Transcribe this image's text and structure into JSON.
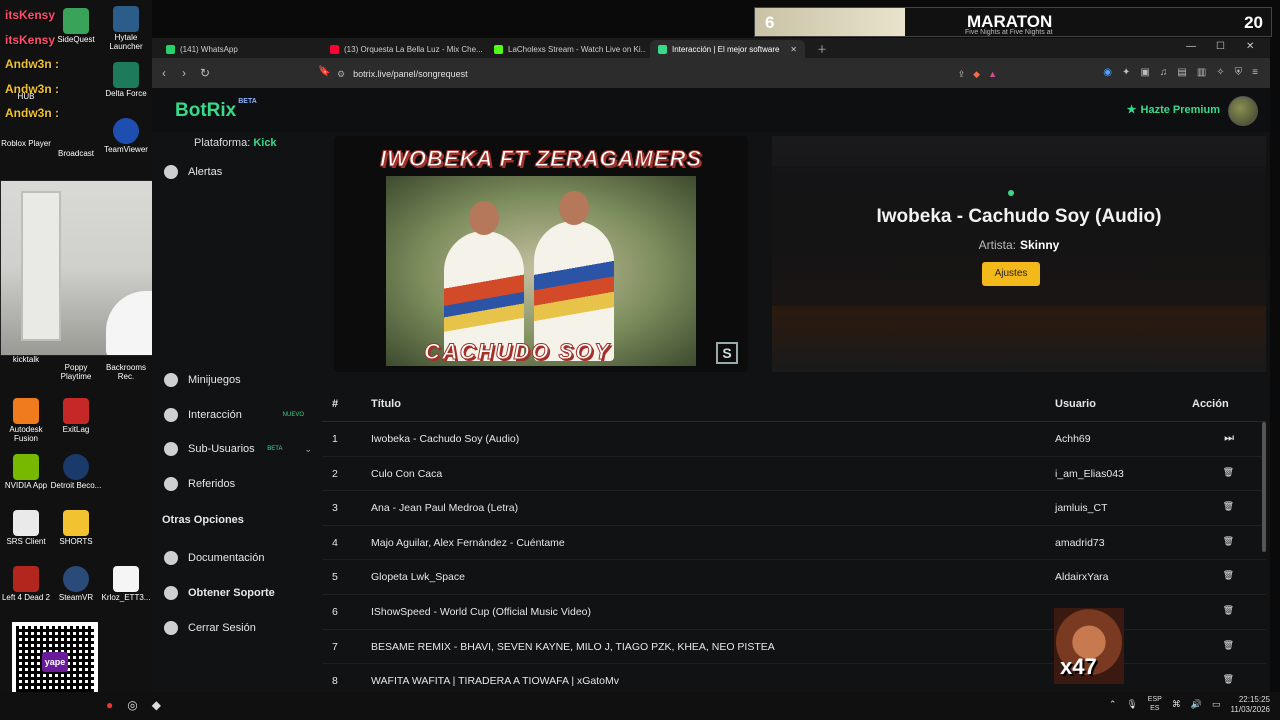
{
  "desktop": {
    "overlay_names": [
      "itsKensy",
      "itsKensy",
      "Andw3n :",
      "Andw3n :",
      "Andw3n :"
    ],
    "icons": [
      {
        "label": "SideQuest"
      },
      {
        "label": "Hytale Launcher"
      },
      {
        "label": "HUB"
      },
      {
        "label": "Delta Force"
      },
      {
        "label": "Roblox Player"
      },
      {
        "label": "Broadcast"
      },
      {
        "label": "TeamViewer"
      },
      {
        "label": "kicktalk"
      },
      {
        "label": "Poppy Playtime"
      },
      {
        "label": "Backrooms Rec."
      },
      {
        "label": "Autodesk Fusion"
      },
      {
        "label": "ExitLag"
      },
      {
        "label": "NVIDIA App"
      },
      {
        "label": "Detroit Beco..."
      },
      {
        "label": "SRS Client"
      },
      {
        "label": "SHORTS"
      },
      {
        "label": "Left 4 Dead 2"
      },
      {
        "label": "SteamVR"
      },
      {
        "label": "Krloz_ETT3..."
      }
    ],
    "qr_label": "yape"
  },
  "maraton": {
    "left_number": "6",
    "title": "MARATON",
    "subtitle": "Five Nights at Five Nights at",
    "right_number": "20",
    "progress": 0.29
  },
  "browser": {
    "tabs": [
      {
        "label": "(141) WhatsApp",
        "color": "#25d366"
      },
      {
        "label": "(13) Orquesta La Bella Luz - Mix Che...",
        "color": "#ff0033"
      },
      {
        "label": "LaCholexs Stream - Watch Live on Ki...",
        "color": "#53fc18"
      },
      {
        "label": "Interacción | El mejor software",
        "color": "#39d98a"
      }
    ],
    "url": "botrix.live/panel/songrequest"
  },
  "app": {
    "logo": "BotRix",
    "logo_badge": "BETA",
    "premium_label": "Hazte Premium",
    "platform_label": "Plataforma:",
    "platform_value": "Kick",
    "nav": [
      {
        "label": "Alertas"
      },
      {
        "label": "Minijuegos"
      },
      {
        "label": "Interacción",
        "badge": "NUEVO"
      },
      {
        "label": "Sub-Usuarios",
        "badge": "BETA"
      },
      {
        "label": "Referidos"
      }
    ],
    "other_options_title": "Otras Opciones",
    "other_nav": [
      {
        "label": "Documentación"
      },
      {
        "label": "Obtener Soporte"
      },
      {
        "label": "Cerrar Sesión"
      }
    ],
    "video": {
      "caption_top": "IWOBEKA FT ZERAGAMERS",
      "caption_bottom": "CACHUDO SOY",
      "watermark": "S"
    },
    "now_playing": {
      "title": "Iwobeka - Cachudo Soy (Audio)",
      "artist_label": "Artista:",
      "artist": "Skinny",
      "settings_button": "Ajustes"
    },
    "queue": {
      "headers": {
        "num": "#",
        "title": "Título",
        "user": "Usuario",
        "action": "Acción"
      },
      "rows": [
        {
          "num": "1",
          "title": "Iwobeka - Cachudo Soy (Audio)",
          "user": "Achh69"
        },
        {
          "num": "2",
          "title": "Culo Con Caca",
          "user": "i_am_Elias043"
        },
        {
          "num": "3",
          "title": "Ana - Jean Paul Medroa (Letra)",
          "user": "jamluis_CT"
        },
        {
          "num": "4",
          "title": "Majo Aguilar, Alex Fernández - Cuéntame",
          "user": "amadrid73"
        },
        {
          "num": "5",
          "title": "Glopeta Lwk_Space",
          "user": "AldairxYara"
        },
        {
          "num": "6",
          "title": "IShowSpeed - World Cup (Official Music Video)",
          "user": ""
        },
        {
          "num": "7",
          "title": "BESAME REMIX - BHAVI, SEVEN KAYNE, MILO J, TIAGO PZK, KHEA, NEO PISTEA",
          "user": ""
        },
        {
          "num": "8",
          "title": "WAFITA WAFITA | TIRADERA A TIOWAFA | xGatoMv",
          "user": "Hectorl2028"
        }
      ]
    },
    "emote_text": "x47"
  },
  "taskbar": {
    "lang_top": "ESP",
    "lang_bottom": "ES",
    "time": "22:15:25",
    "date": "11/03/2026"
  }
}
